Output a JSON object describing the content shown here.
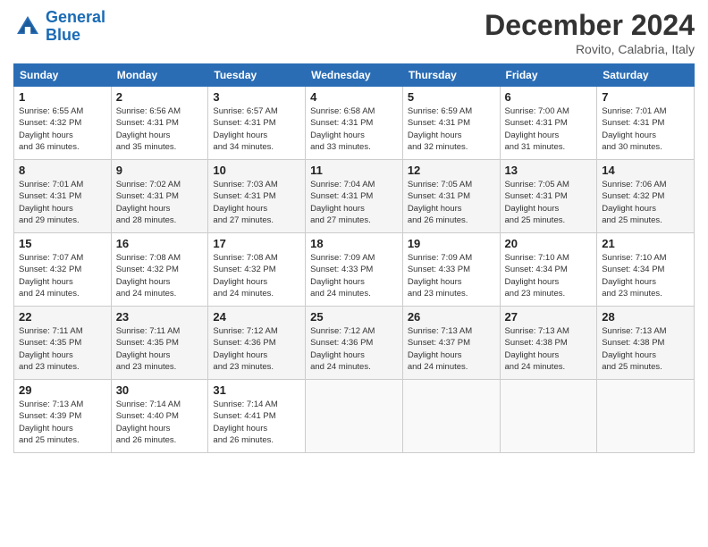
{
  "logo": {
    "line1": "General",
    "line2": "Blue"
  },
  "title": "December 2024",
  "location": "Rovito, Calabria, Italy",
  "headers": [
    "Sunday",
    "Monday",
    "Tuesday",
    "Wednesday",
    "Thursday",
    "Friday",
    "Saturday"
  ],
  "weeks": [
    [
      {
        "day": "1",
        "sunrise": "6:55 AM",
        "sunset": "4:32 PM",
        "daylight": "9 hours and 36 minutes."
      },
      {
        "day": "2",
        "sunrise": "6:56 AM",
        "sunset": "4:31 PM",
        "daylight": "9 hours and 35 minutes."
      },
      {
        "day": "3",
        "sunrise": "6:57 AM",
        "sunset": "4:31 PM",
        "daylight": "9 hours and 34 minutes."
      },
      {
        "day": "4",
        "sunrise": "6:58 AM",
        "sunset": "4:31 PM",
        "daylight": "9 hours and 33 minutes."
      },
      {
        "day": "5",
        "sunrise": "6:59 AM",
        "sunset": "4:31 PM",
        "daylight": "9 hours and 32 minutes."
      },
      {
        "day": "6",
        "sunrise": "7:00 AM",
        "sunset": "4:31 PM",
        "daylight": "9 hours and 31 minutes."
      },
      {
        "day": "7",
        "sunrise": "7:01 AM",
        "sunset": "4:31 PM",
        "daylight": "9 hours and 30 minutes."
      }
    ],
    [
      {
        "day": "8",
        "sunrise": "7:01 AM",
        "sunset": "4:31 PM",
        "daylight": "9 hours and 29 minutes."
      },
      {
        "day": "9",
        "sunrise": "7:02 AM",
        "sunset": "4:31 PM",
        "daylight": "9 hours and 28 minutes."
      },
      {
        "day": "10",
        "sunrise": "7:03 AM",
        "sunset": "4:31 PM",
        "daylight": "9 hours and 27 minutes."
      },
      {
        "day": "11",
        "sunrise": "7:04 AM",
        "sunset": "4:31 PM",
        "daylight": "9 hours and 27 minutes."
      },
      {
        "day": "12",
        "sunrise": "7:05 AM",
        "sunset": "4:31 PM",
        "daylight": "9 hours and 26 minutes."
      },
      {
        "day": "13",
        "sunrise": "7:05 AM",
        "sunset": "4:31 PM",
        "daylight": "9 hours and 25 minutes."
      },
      {
        "day": "14",
        "sunrise": "7:06 AM",
        "sunset": "4:32 PM",
        "daylight": "9 hours and 25 minutes."
      }
    ],
    [
      {
        "day": "15",
        "sunrise": "7:07 AM",
        "sunset": "4:32 PM",
        "daylight": "9 hours and 24 minutes."
      },
      {
        "day": "16",
        "sunrise": "7:08 AM",
        "sunset": "4:32 PM",
        "daylight": "9 hours and 24 minutes."
      },
      {
        "day": "17",
        "sunrise": "7:08 AM",
        "sunset": "4:32 PM",
        "daylight": "9 hours and 24 minutes."
      },
      {
        "day": "18",
        "sunrise": "7:09 AM",
        "sunset": "4:33 PM",
        "daylight": "9 hours and 24 minutes."
      },
      {
        "day": "19",
        "sunrise": "7:09 AM",
        "sunset": "4:33 PM",
        "daylight": "9 hours and 23 minutes."
      },
      {
        "day": "20",
        "sunrise": "7:10 AM",
        "sunset": "4:34 PM",
        "daylight": "9 hours and 23 minutes."
      },
      {
        "day": "21",
        "sunrise": "7:10 AM",
        "sunset": "4:34 PM",
        "daylight": "9 hours and 23 minutes."
      }
    ],
    [
      {
        "day": "22",
        "sunrise": "7:11 AM",
        "sunset": "4:35 PM",
        "daylight": "9 hours and 23 minutes."
      },
      {
        "day": "23",
        "sunrise": "7:11 AM",
        "sunset": "4:35 PM",
        "daylight": "9 hours and 23 minutes."
      },
      {
        "day": "24",
        "sunrise": "7:12 AM",
        "sunset": "4:36 PM",
        "daylight": "9 hours and 23 minutes."
      },
      {
        "day": "25",
        "sunrise": "7:12 AM",
        "sunset": "4:36 PM",
        "daylight": "9 hours and 24 minutes."
      },
      {
        "day": "26",
        "sunrise": "7:13 AM",
        "sunset": "4:37 PM",
        "daylight": "9 hours and 24 minutes."
      },
      {
        "day": "27",
        "sunrise": "7:13 AM",
        "sunset": "4:38 PM",
        "daylight": "9 hours and 24 minutes."
      },
      {
        "day": "28",
        "sunrise": "7:13 AM",
        "sunset": "4:38 PM",
        "daylight": "9 hours and 25 minutes."
      }
    ],
    [
      {
        "day": "29",
        "sunrise": "7:13 AM",
        "sunset": "4:39 PM",
        "daylight": "9 hours and 25 minutes."
      },
      {
        "day": "30",
        "sunrise": "7:14 AM",
        "sunset": "4:40 PM",
        "daylight": "9 hours and 26 minutes."
      },
      {
        "day": "31",
        "sunrise": "7:14 AM",
        "sunset": "4:41 PM",
        "daylight": "9 hours and 26 minutes."
      },
      null,
      null,
      null,
      null
    ]
  ]
}
